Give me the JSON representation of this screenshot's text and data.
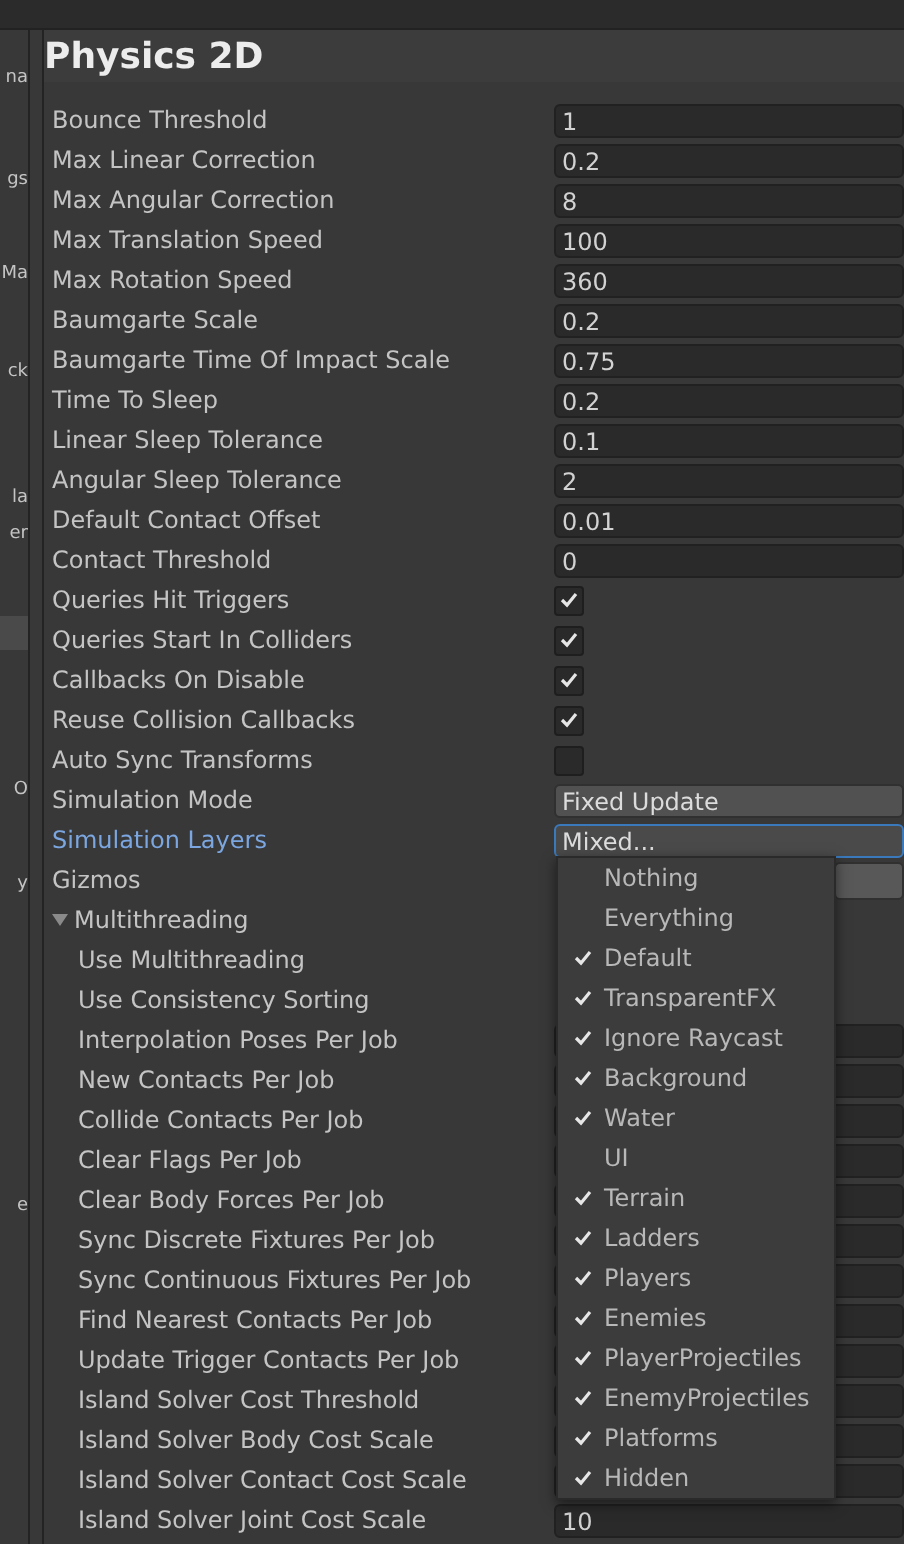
{
  "sidebar": {
    "items": [
      {
        "label": "na",
        "selected": false
      },
      {
        "label": "gs",
        "selected": false
      },
      {
        "label": "Ma",
        "selected": false
      },
      {
        "label": "ck",
        "selected": false
      },
      {
        "label": "la",
        "selected": false
      },
      {
        "label": "er",
        "selected": false
      },
      {
        "selected": true
      },
      {
        "label": "O",
        "selected": false
      },
      {
        "label": "y",
        "selected": false
      },
      {
        "label": "e",
        "selected": false
      }
    ]
  },
  "title": "Physics 2D",
  "rows": [
    {
      "label": "Bounce Threshold",
      "kind": "number",
      "value": "1"
    },
    {
      "label": "Max Linear Correction",
      "kind": "number",
      "value": "0.2"
    },
    {
      "label": "Max Angular Correction",
      "kind": "number",
      "value": "8"
    },
    {
      "label": "Max Translation Speed",
      "kind": "number",
      "value": "100"
    },
    {
      "label": "Max Rotation Speed",
      "kind": "number",
      "value": "360"
    },
    {
      "label": "Baumgarte Scale",
      "kind": "number",
      "value": "0.2"
    },
    {
      "label": "Baumgarte Time Of Impact Scale",
      "kind": "number",
      "value": "0.75"
    },
    {
      "label": "Time To Sleep",
      "kind": "number",
      "value": "0.2"
    },
    {
      "label": "Linear Sleep Tolerance",
      "kind": "number",
      "value": "0.1"
    },
    {
      "label": "Angular Sleep Tolerance",
      "kind": "number",
      "value": "2"
    },
    {
      "label": "Default Contact Offset",
      "kind": "number",
      "value": "0.01"
    },
    {
      "label": "Contact Threshold",
      "kind": "number",
      "value": "0"
    },
    {
      "label": "Queries Hit Triggers",
      "kind": "checkbox",
      "checked": true
    },
    {
      "label": "Queries Start In Colliders",
      "kind": "checkbox",
      "checked": true
    },
    {
      "label": "Callbacks On Disable",
      "kind": "checkbox",
      "checked": true
    },
    {
      "label": "Reuse Collision Callbacks",
      "kind": "checkbox",
      "checked": true
    },
    {
      "label": "Auto Sync Transforms",
      "kind": "checkbox",
      "checked": false
    },
    {
      "label": "Simulation Mode",
      "kind": "enum",
      "value": "Fixed Update",
      "focused": false
    },
    {
      "label": "Simulation Layers",
      "kind": "enum",
      "value": "Mixed...",
      "focused": true
    },
    {
      "label": "Gizmos",
      "kind": "button"
    },
    {
      "label": "Multithreading",
      "kind": "foldout",
      "expanded": true,
      "children": [
        {
          "label": "Use Multithreading",
          "kind": "covered"
        },
        {
          "label": "Use Consistency Sorting",
          "kind": "covered"
        },
        {
          "label": "Interpolation Poses Per Job",
          "kind": "number"
        },
        {
          "label": "New Contacts Per Job",
          "kind": "number"
        },
        {
          "label": "Collide Contacts Per Job",
          "kind": "number"
        },
        {
          "label": "Clear Flags Per Job",
          "kind": "number"
        },
        {
          "label": "Clear Body Forces Per Job",
          "kind": "number"
        },
        {
          "label": "Sync Discrete Fixtures Per Job",
          "kind": "number"
        },
        {
          "label": "Sync Continuous Fixtures Per Job",
          "kind": "number"
        },
        {
          "label": "Find Nearest Contacts Per Job",
          "kind": "number"
        },
        {
          "label": "Update Trigger Contacts Per Job",
          "kind": "number"
        },
        {
          "label": "Island Solver Cost Threshold",
          "kind": "number"
        },
        {
          "label": "Island Solver Body Cost Scale",
          "kind": "number"
        },
        {
          "label": "Island Solver Contact Cost Scale",
          "kind": "number"
        },
        {
          "label": "Island Solver Joint Cost Scale",
          "kind": "number",
          "value": "10"
        }
      ]
    }
  ],
  "layer_menu": {
    "items": [
      {
        "label": "Nothing",
        "checked": false
      },
      {
        "label": "Everything",
        "checked": false
      },
      {
        "label": "Default",
        "checked": true
      },
      {
        "label": "TransparentFX",
        "checked": true
      },
      {
        "label": "Ignore Raycast",
        "checked": true
      },
      {
        "label": "Background",
        "checked": true
      },
      {
        "label": "Water",
        "checked": true
      },
      {
        "label": "UI",
        "checked": false
      },
      {
        "label": "Terrain",
        "checked": true
      },
      {
        "label": "Ladders",
        "checked": true
      },
      {
        "label": "Players",
        "checked": true
      },
      {
        "label": "Enemies",
        "checked": true
      },
      {
        "label": "PlayerProjectiles",
        "checked": true
      },
      {
        "label": "EnemyProjectiles",
        "checked": true
      },
      {
        "label": "Platforms",
        "checked": true
      },
      {
        "label": "Hidden",
        "checked": true
      }
    ]
  }
}
